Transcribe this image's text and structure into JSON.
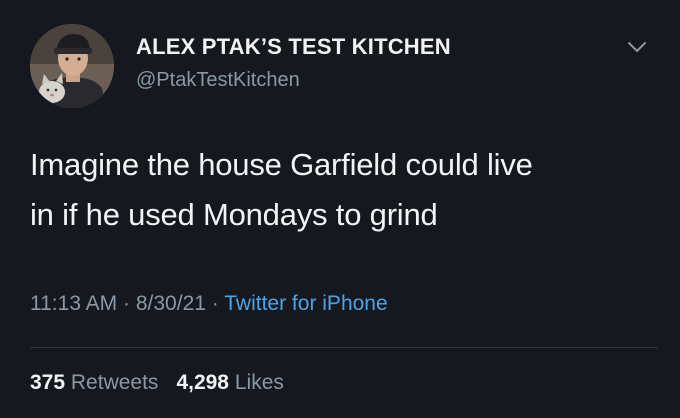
{
  "account": {
    "display_name": "ALEX PTAK’S TEST KITCHEN",
    "handle": "@PtakTestKitchen"
  },
  "tweet": {
    "text_line1": "Imagine the house Garfield could live",
    "text_line2": "in if he used Mondays to grind"
  },
  "meta": {
    "time": "11:13 AM",
    "separator": "·",
    "date": "8/30/21",
    "source": "Twitter for iPhone"
  },
  "stats": {
    "retweets_count": "375",
    "retweets_label": "Retweets",
    "likes_count": "4,298",
    "likes_label": "Likes"
  },
  "icons": {
    "menu": "chevron-down-icon"
  },
  "colors": {
    "background": "#15181f",
    "link": "#4ea3e8",
    "secondary_text": "#8b98a5"
  }
}
